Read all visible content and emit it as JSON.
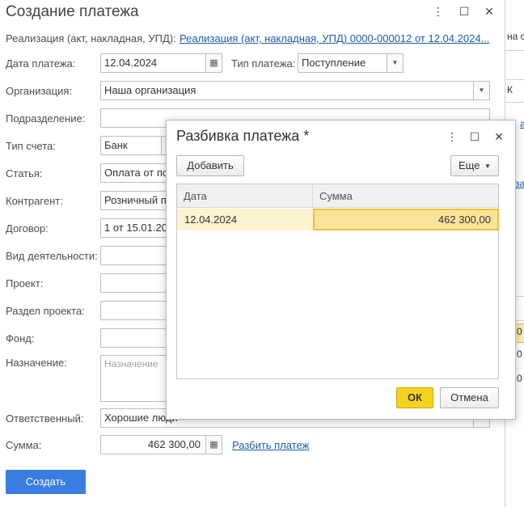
{
  "window": {
    "title": "Создание платежа",
    "menu_icon": "⋮",
    "maximize_icon": "☐",
    "close_icon": "✕"
  },
  "form": {
    "sale_label": "Реализация (акт, накладная, УПД):",
    "sale_link": "Реализация (акт, накладная, УПД) 0000-000012 от 12.04.2024...",
    "date_label": "Дата платежа:",
    "date_value": "12.04.2024",
    "payment_type_label": "Тип платежа:",
    "payment_type_value": "Поступление",
    "org_label": "Организация:",
    "org_value": "Наша организация",
    "division_label": "Подразделение:",
    "division_value": "",
    "account_type_label": "Тип счета:",
    "account_type_value": "Банк",
    "article_label": "Статья:",
    "article_value": "Оплата от по",
    "counterparty_label": "Контрагент:",
    "counterparty_value": "Розничный п",
    "contract_label": "Договор:",
    "contract_value": "1 от 15.01.20",
    "activity_label": "Вид деятельности:",
    "activity_value": "",
    "project_label": "Проект:",
    "project_value": "",
    "project_section_label": "Раздел проекта:",
    "project_section_value": "",
    "fund_label": "Фонд:",
    "fund_value": "",
    "purpose_label": "Назначение:",
    "purpose_placeholder": "Назначение",
    "responsible_label": "Ответственный:",
    "responsible_value": "Хорошие люди",
    "amount_label": "Сумма:",
    "amount_value": "462 300,00",
    "split_link": "Разбить платеж",
    "create_button": "Создать"
  },
  "modal": {
    "title": "Разбивка платежа *",
    "add_button": "Добавить",
    "more_button": "Еще",
    "columns": [
      "Дата",
      "Сумма"
    ],
    "rows": [
      {
        "date": "12.04.2024",
        "amount": "462 300,00"
      }
    ],
    "ok_button": "ОК",
    "cancel_button": "Отмена"
  },
  "background": {
    "frag1": "на с",
    "frag2": "К",
    "frag3": "а",
    "frag4": "за",
    "frag5": "0",
    "frag6": "0",
    "frag7": "0"
  },
  "colors": {
    "accent_blue": "#3a7de0",
    "link": "#1a5ea8",
    "ok_yellow": "#f5d31f",
    "row_highlight": "#fdf3cf"
  }
}
